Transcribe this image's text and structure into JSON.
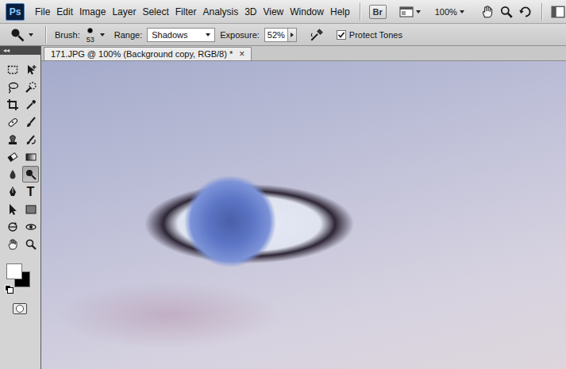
{
  "app": {
    "logo": "Ps"
  },
  "menus": [
    "File",
    "Edit",
    "Image",
    "Layer",
    "Select",
    "Filter",
    "Analysis",
    "3D",
    "View",
    "Window",
    "Help"
  ],
  "app_bar": {
    "bridge": "Br",
    "zoom": "100%"
  },
  "options": {
    "brush_label": "Brush:",
    "brush_size": "53",
    "range_label": "Range:",
    "range": "Shadows",
    "exposure_label": "Exposure:",
    "exposure": "52%",
    "protect_tones": {
      "label": "Protect Tones",
      "checked": true
    }
  },
  "document": {
    "tab": "171.JPG @ 100% (Background copy, RGB/8) *",
    "close": "×"
  },
  "tools": {
    "collapse": "◂◂",
    "items": [
      {
        "kind": "marquee",
        "selected": false
      },
      {
        "kind": "move",
        "selected": false
      },
      {
        "kind": "lasso",
        "selected": false
      },
      {
        "kind": "quick-selection",
        "selected": false
      },
      {
        "kind": "crop",
        "selected": false
      },
      {
        "kind": "eyedropper",
        "selected": false
      },
      {
        "kind": "healing",
        "selected": false
      },
      {
        "kind": "brush",
        "selected": false
      },
      {
        "kind": "clone",
        "selected": false
      },
      {
        "kind": "history",
        "selected": false
      },
      {
        "kind": "eraser",
        "selected": false
      },
      {
        "kind": "gradient",
        "selected": false
      },
      {
        "kind": "blur",
        "selected": false
      },
      {
        "kind": "dodge",
        "selected": true
      },
      {
        "kind": "pen",
        "selected": false
      },
      {
        "kind": "type",
        "selected": false,
        "glyph": "T"
      },
      {
        "kind": "path-select",
        "selected": false
      },
      {
        "kind": "shape",
        "selected": false
      },
      {
        "kind": "rotate-3d",
        "selected": false
      },
      {
        "kind": "orbit-3d",
        "selected": false
      },
      {
        "kind": "hand",
        "selected": false
      },
      {
        "kind": "zoom",
        "selected": false
      }
    ]
  },
  "colors": {
    "foreground": "#ffffff",
    "background": "#000000"
  }
}
